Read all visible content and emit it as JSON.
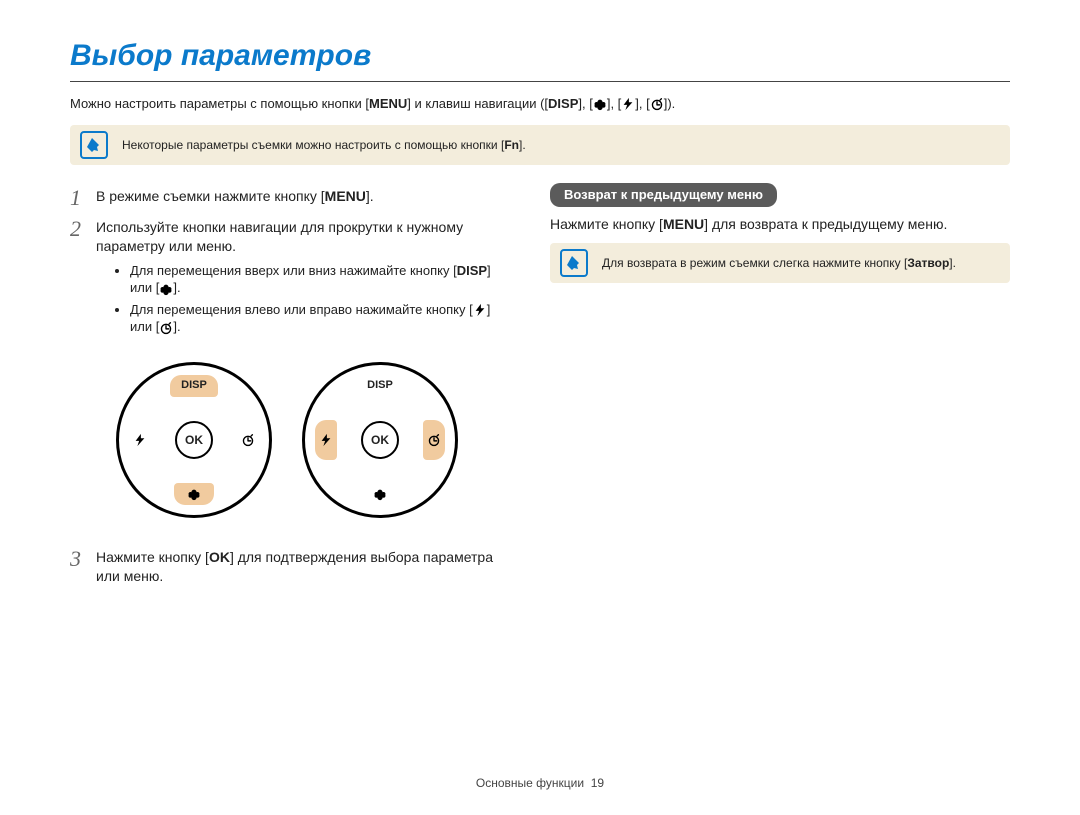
{
  "title": "Выбор параметров",
  "intro_parts": {
    "p1": "Можно настроить параметры с помощью кнопки [",
    "p2": "] и клавиш навигации ([",
    "p3": "], [",
    "p4": "], [",
    "p5": "], [",
    "p6": "]).",
    "menu_label": "MENU",
    "disp_label": "DISP"
  },
  "note1": {
    "text": "Некоторые параметры съемки можно настроить с помощью кнопки [",
    "end": "].",
    "fn": "Fn"
  },
  "steps": {
    "s1": {
      "a": "В режиме съемки нажмите кнопку [",
      "b": "].",
      "menu": "MENU"
    },
    "s2": {
      "main": "Используйте кнопки навигации для прокрутки к нужному параметру или меню.",
      "b1a": "Для перемещения вверх или вниз нажимайте кнопку [",
      "b1b": "] или [",
      "b1c": "].",
      "disp": "DISP",
      "b2a": "Для перемещения влево или вправо нажимайте кнопку [",
      "b2b": "] или [",
      "b2c": "]."
    },
    "s3": {
      "a": "Нажмите кнопку [",
      "b": "] для подтверждения выбора параметра или меню.",
      "ok": "OK"
    }
  },
  "dial": {
    "disp": "DISP",
    "ok": "OK"
  },
  "right": {
    "pill": "Возврат к предыдущему меню",
    "p_a": "Нажмите кнопку [",
    "p_b": "] для возврата к предыдущему меню.",
    "menu": "MENU",
    "note_a": "Для возврата в режим съемки слегка нажмите кнопку [",
    "note_b": "].",
    "shutter": "Затвор"
  },
  "footer": {
    "section": "Основные функции",
    "page": "19"
  }
}
